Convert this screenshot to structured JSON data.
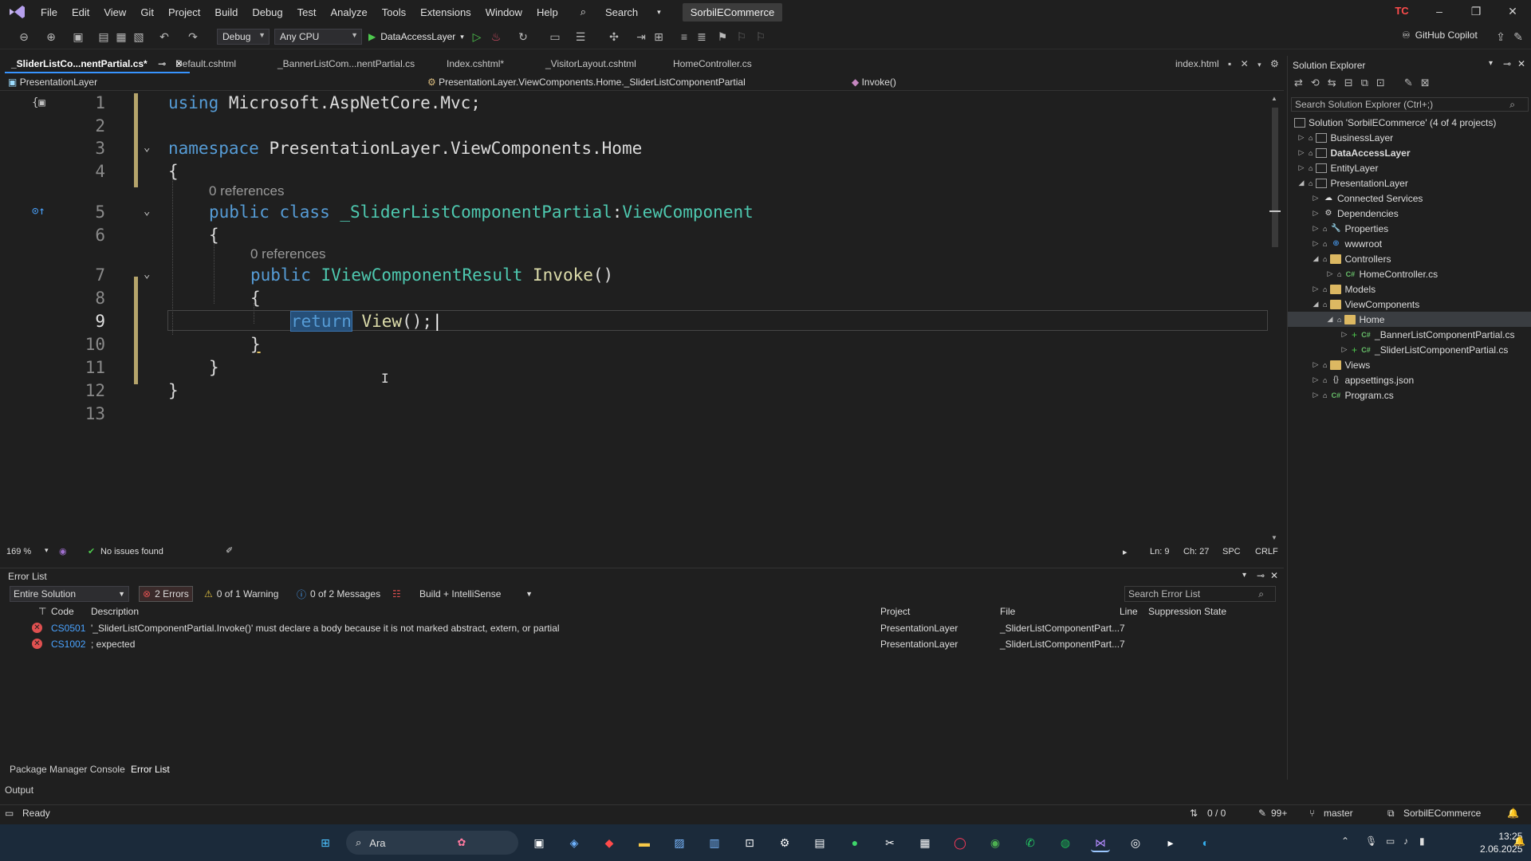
{
  "menu": {
    "items": [
      "File",
      "Edit",
      "View",
      "Git",
      "Project",
      "Build",
      "Debug",
      "Test",
      "Analyze",
      "Tools",
      "Extensions",
      "Window",
      "Help"
    ],
    "search_label": "Search",
    "solution_name": "SorbilECommerce",
    "avatar": "TC"
  },
  "toolbar": {
    "config": "Debug",
    "platform": "Any CPU",
    "startup_project": "DataAccessLayer",
    "copilot_label": "GitHub Copilot"
  },
  "tabs": [
    {
      "label": "_SliderListCo...nentPartial.cs*",
      "active": true
    },
    {
      "label": "Default.cshtml"
    },
    {
      "label": "_BannerListCom...nentPartial.cs"
    },
    {
      "label": "Index.cshtml*"
    },
    {
      "label": "_VisitorLayout.cshtml"
    },
    {
      "label": "HomeController.cs"
    },
    {
      "label": "index.html"
    }
  ],
  "navbar": {
    "project": "PresentationLayer",
    "type": "PresentationLayer.ViewComponents.Home._SliderListComponentPartial",
    "member": "Invoke()"
  },
  "editor": {
    "line_numbers": [
      "1",
      "2",
      "3",
      "4",
      "5",
      "6",
      "7",
      "8",
      "9",
      "10",
      "11",
      "12",
      "13"
    ],
    "code": {
      "l1_kw": "using",
      "l1_rest": " Microsoft.AspNetCore.Mvc;",
      "l3_kw": "namespace",
      "l3_rest": " PresentationLayer.ViewComponents.Home",
      "l4": "{",
      "ref1": "0 references",
      "l5_kw": "public class",
      "l5_name": " _SliderListComponentPartial",
      "l5_sep": ":",
      "l5_base": "ViewComponent",
      "l6": "{",
      "ref2": "0 references",
      "l7_kw": "public",
      "l7_type": " IViewComponentResult",
      "l7_fn": " Invoke",
      "l7_rest": "()",
      "l8": "{",
      "l9_kw": "return",
      "l9_fn": " View",
      "l9_rest": "();",
      "l10": "}",
      "l11": "}",
      "l12": "}"
    }
  },
  "editor_status": {
    "zoom": "169 %",
    "issues": "No issues found",
    "ln": "Ln: 9",
    "ch": "Ch: 27",
    "spc": "SPC",
    "eol": "CRLF"
  },
  "error_list": {
    "title": "Error List",
    "scope": "Entire Solution",
    "errors": "2 Errors",
    "warnings": "0 of 1 Warning",
    "messages": "0 of 2 Messages",
    "build_filter": "Build + IntelliSense",
    "search_placeholder": "Search Error List",
    "columns": {
      "code": "Code",
      "description": "Description",
      "project": "Project",
      "file": "File",
      "line": "Line",
      "suppression": "Suppression State"
    },
    "rows": [
      {
        "code": "CS0501",
        "description": "'_SliderListComponentPartial.Invoke()' must declare a body because it is not marked abstract, extern, or partial",
        "project": "PresentationLayer",
        "file": "_SliderListComponentPart...",
        "line": "7"
      },
      {
        "code": "CS1002",
        "description": "; expected",
        "project": "PresentationLayer",
        "file": "_SliderListComponentPart...",
        "line": "7"
      }
    ]
  },
  "bottom_tabs": {
    "pmc": "Package Manager Console",
    "errors": "Error List",
    "output": "Output"
  },
  "solution_explorer": {
    "title": "Solution Explorer",
    "search_placeholder": "Search Solution Explorer (Ctrl+;)",
    "nodes": {
      "solution": "Solution 'SorbilECommerce' (4 of 4 projects)",
      "business": "BusinessLayer",
      "dataaccess": "DataAccessLayer",
      "entity": "EntityLayer",
      "presentation": "PresentationLayer",
      "connected": "Connected Services",
      "dependencies": "Dependencies",
      "properties": "Properties",
      "wwwroot": "wwwroot",
      "controllers": "Controllers",
      "homecontroller": "HomeController.cs",
      "models": "Models",
      "viewcomponents": "ViewComponents",
      "home": "Home",
      "banner": "_BannerListComponentPartial.cs",
      "slider": "_SliderListComponentPartial.cs",
      "views": "Views",
      "appsettings": "appsettings.json",
      "program": "Program.cs"
    }
  },
  "statusbar": {
    "ready": "Ready",
    "changes": "0 / 0",
    "edits": "99+",
    "branch": "master",
    "solution": "SorbilECommerce"
  },
  "taskbar": {
    "search_label": "Ara",
    "time": "13:25",
    "date": "2.06.2025"
  }
}
